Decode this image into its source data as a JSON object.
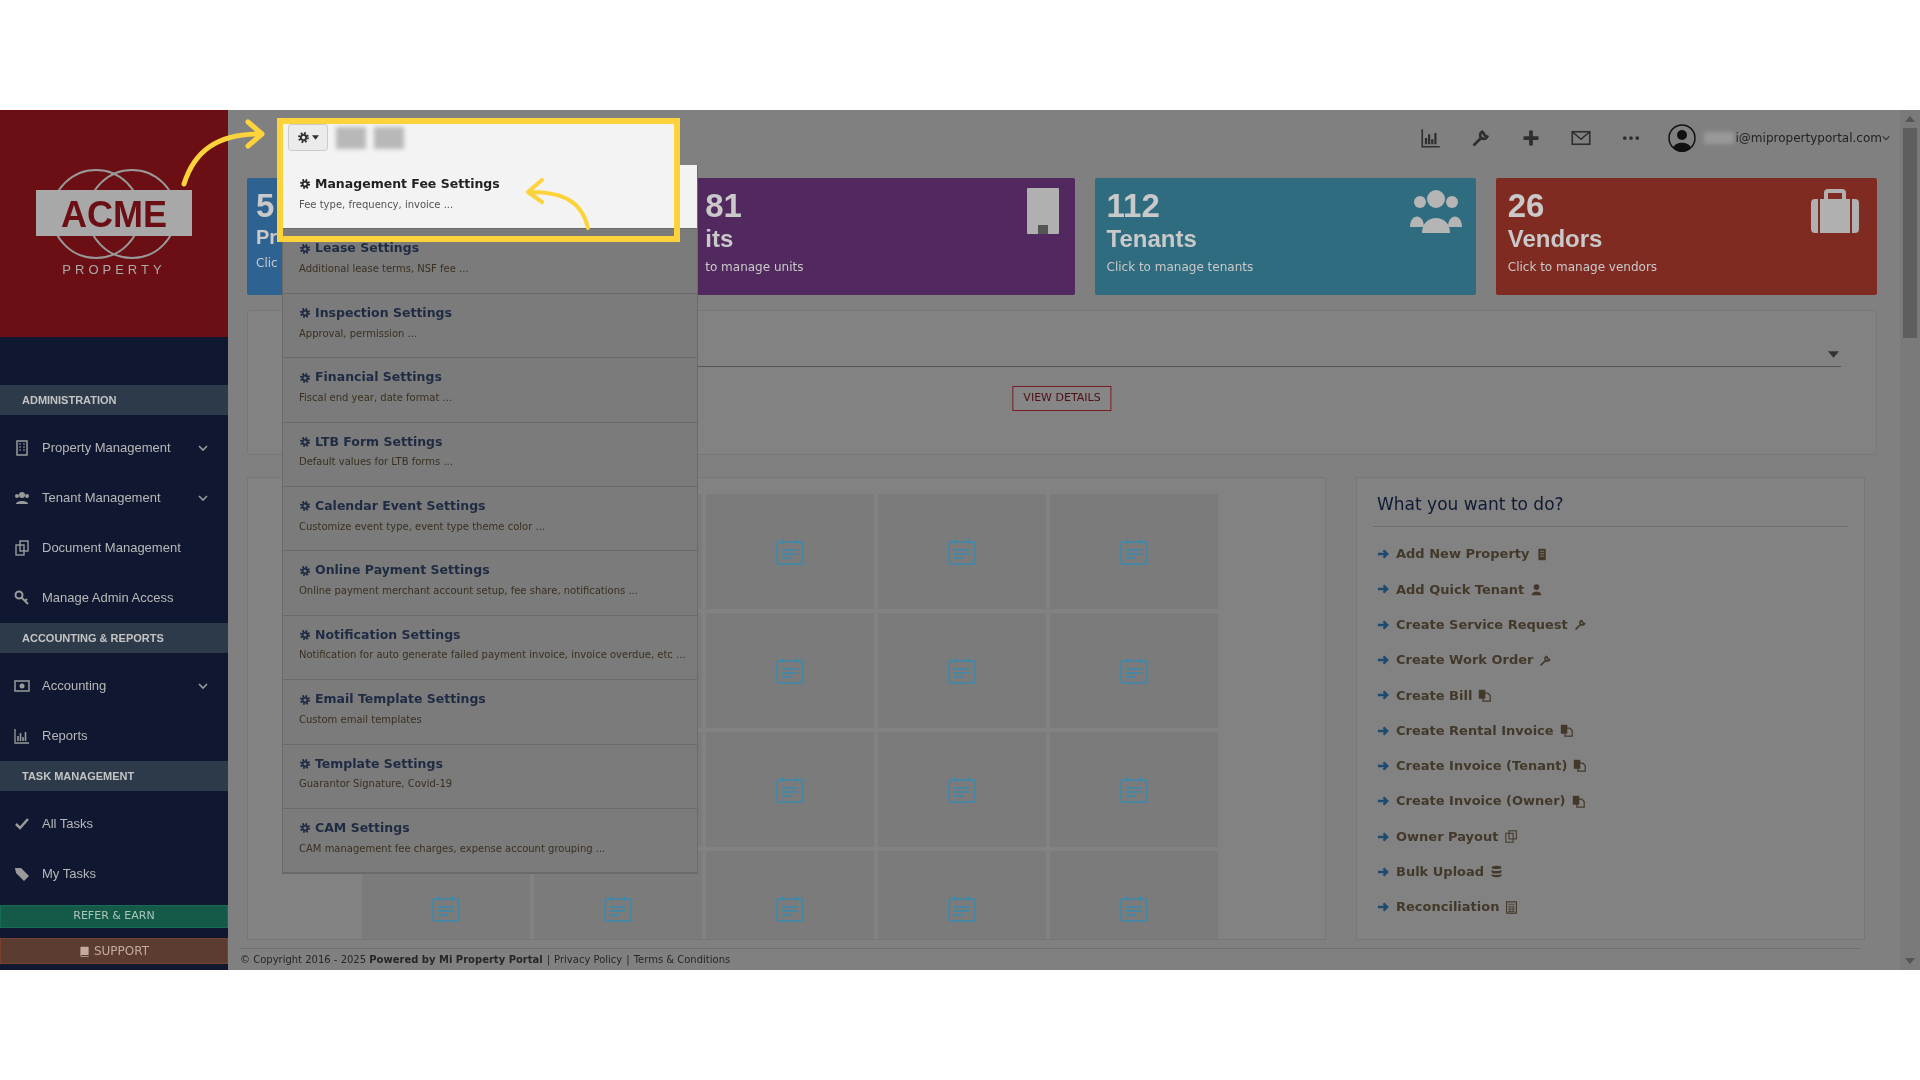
{
  "sidebar": {
    "logo": {
      "wordmark": "ACME",
      "tagline": "PROPERTY"
    },
    "sections": [
      {
        "title": "ADMINISTRATION",
        "items": [
          {
            "label": "Property Management",
            "kind": "submenu"
          },
          {
            "label": "Tenant Management",
            "kind": "submenu"
          },
          {
            "label": "Document Management",
            "kind": "link"
          },
          {
            "label": "Manage Admin Access",
            "kind": "link"
          }
        ]
      },
      {
        "title": "ACCOUNTING & REPORTS",
        "items": [
          {
            "label": "Accounting",
            "kind": "submenu"
          },
          {
            "label": "Reports",
            "kind": "link"
          }
        ]
      },
      {
        "title": "TASK MANAGEMENT",
        "items": [
          {
            "label": "All Tasks",
            "kind": "link"
          },
          {
            "label": "My Tasks",
            "kind": "link"
          }
        ]
      }
    ],
    "refer_button": "REFER & EARN",
    "support_button": "SUPPORT"
  },
  "topbar": {
    "user_email": "i@mipropertyportal.com"
  },
  "settings_menu": {
    "items": [
      {
        "title": "Management Fee Settings",
        "subtitle": "Fee type, frequency, invoice ...",
        "selected": true
      },
      {
        "title": "Lease Settings",
        "subtitle": "Additional lease terms, NSF fee ...",
        "selected": false
      },
      {
        "title": "Inspection Settings",
        "subtitle": "Approval, permission ...",
        "selected": false
      },
      {
        "title": "Financial Settings",
        "subtitle": "Fiscal end year, date format ...",
        "selected": false
      },
      {
        "title": "LTB Form Settings",
        "subtitle": "Default values for LTB forms ...",
        "selected": false
      },
      {
        "title": "Calendar Event Settings",
        "subtitle": "Customize event type, event type theme color ...",
        "selected": false
      },
      {
        "title": "Online Payment Settings",
        "subtitle": "Online payment merchant account setup, fee share, notifications ...",
        "selected": false
      },
      {
        "title": "Notification Settings",
        "subtitle": "Notification for auto generate failed payment invoice, invoice overdue, etc ...",
        "selected": false
      },
      {
        "title": "Email Template Settings",
        "subtitle": "Custom email templates",
        "selected": false
      },
      {
        "title": "Template Settings",
        "subtitle": "Guarantor Signature, Covid-19",
        "selected": false
      },
      {
        "title": "CAM Settings",
        "subtitle": "CAM management fee charges, expense account grouping ...",
        "selected": false
      }
    ]
  },
  "stat_cards": [
    {
      "number": "5",
      "label": "Pr",
      "link": "Clic",
      "color": "#2d6291"
    },
    {
      "number": "81",
      "label": "its",
      "link": "to manage units",
      "color": "#52295f"
    },
    {
      "number": "112",
      "label": "Tenants",
      "link": "Click to manage tenants",
      "color": "#2f6c7f"
    },
    {
      "number": "26",
      "label": "Vendors",
      "link": "Click to manage vendors",
      "color": "#7f2b22"
    }
  ],
  "summary_panel": {
    "button": "VIEW DETAILS"
  },
  "quick_actions": {
    "title": "What you want to do?",
    "items": [
      "Add New Property",
      "Add Quick Tenant",
      "Create Service Request",
      "Create Work Order",
      "Create Bill",
      "Create Rental Invoice",
      "Create Invoice (Tenant)",
      "Create Invoice (Owner)",
      "Owner Payout",
      "Bulk Upload",
      "Reconciliation"
    ]
  },
  "footer": {
    "text": "© Copyright 2016 - 2025 **Powered by Mi Property Portal**",
    "separator": "|",
    "links": [
      "Privacy Policy",
      "Terms & Conditions"
    ]
  }
}
